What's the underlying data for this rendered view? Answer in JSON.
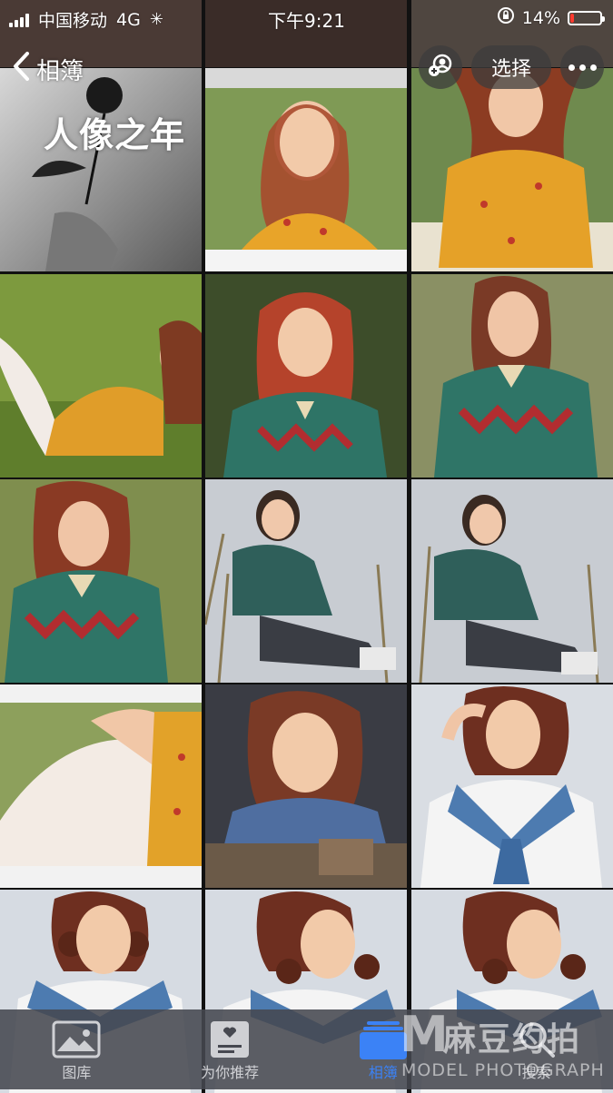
{
  "status_bar": {
    "carrier": "中国移动",
    "network": "4G",
    "time": "下午9:21",
    "battery_percent": "14%",
    "battery_level": 0.14,
    "battery_color": "#ff3b30"
  },
  "nav": {
    "back_label": "相簿",
    "album_title": "人像之年",
    "select_label": "选择"
  },
  "photos": [
    {
      "id": "p1",
      "description": "black-white rose in hand"
    },
    {
      "id": "p2",
      "description": "red-haired girl in yellow dress waving"
    },
    {
      "id": "p3",
      "description": "girl in yellow dress sitting on blanket"
    },
    {
      "id": "p4",
      "description": "girl in yellow dress lying in grass"
    },
    {
      "id": "p5",
      "description": "red-haired girl in argyle top posing"
    },
    {
      "id": "p6",
      "description": "girl with braids in argyle top"
    },
    {
      "id": "p7",
      "description": "girl with braids in argyle top close"
    },
    {
      "id": "p8",
      "description": "girl in green sweater sitting in reeds"
    },
    {
      "id": "p9",
      "description": "girl in green sweater sitting in reeds"
    },
    {
      "id": "p10",
      "description": "legs in white lace stockings"
    },
    {
      "id": "p11",
      "description": "girl leaning on wooden crate"
    },
    {
      "id": "p12",
      "description": "girl in sailor uniform hand on head"
    },
    {
      "id": "p13",
      "description": "girl in sailor uniform portrait"
    },
    {
      "id": "p14",
      "description": "girl in sailor uniform portrait"
    },
    {
      "id": "p15",
      "description": "girl in sailor uniform portrait"
    }
  ],
  "tab_bar": {
    "tabs": [
      {
        "label": "图库",
        "icon": "photo-library-icon",
        "active": false
      },
      {
        "label": "为你推荐",
        "icon": "for-you-icon",
        "active": false
      },
      {
        "label": "相簿",
        "icon": "albums-icon",
        "active": true
      },
      {
        "label": "搜索",
        "icon": "search-icon",
        "active": false
      }
    ],
    "active_color": "#3b82f6"
  },
  "watermark": {
    "brand_cn": "麻豆约拍",
    "brand_en": "MODEL PHOTOGRAPH"
  }
}
